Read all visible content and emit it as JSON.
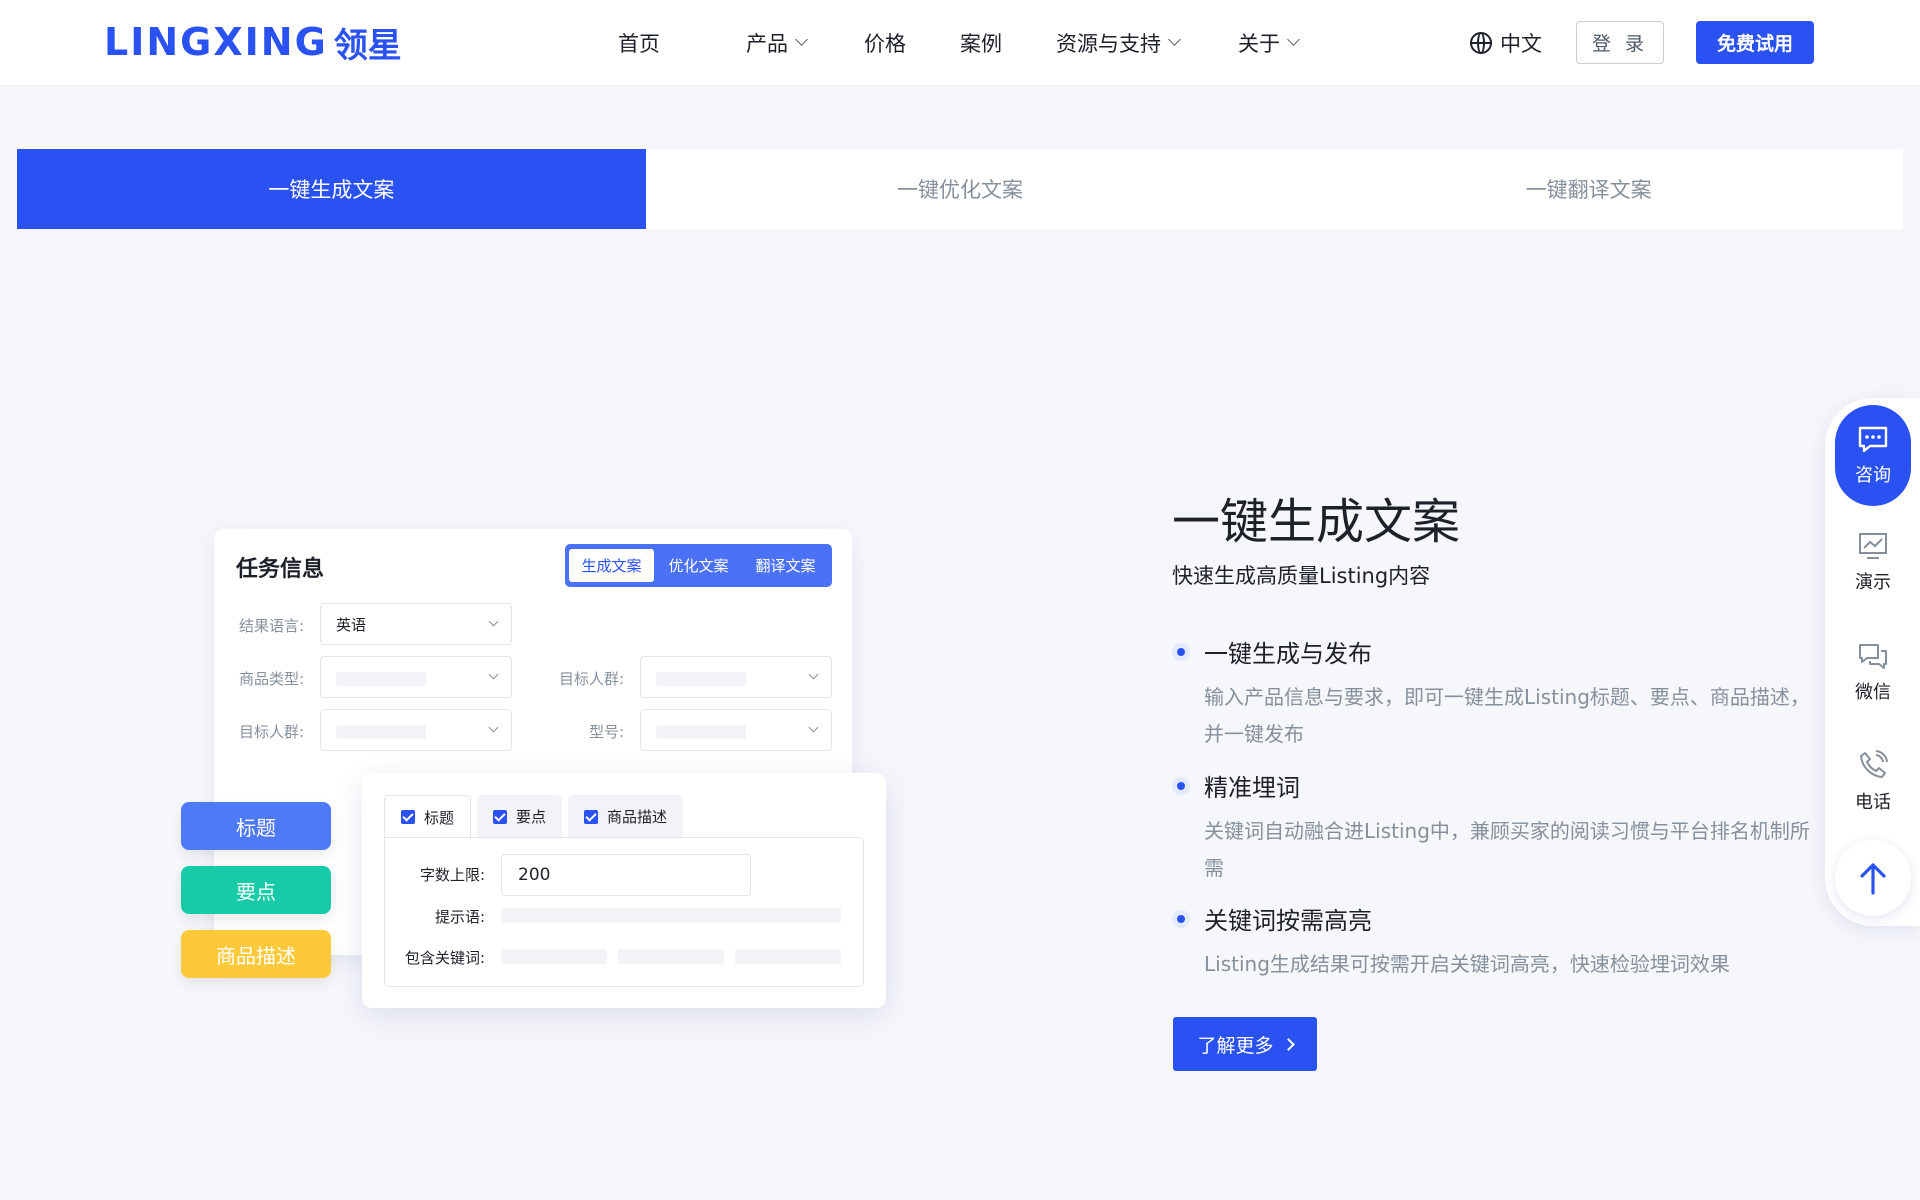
{
  "nav": {
    "logo_en": "LINGXING",
    "logo_cn": "领星",
    "menu": [
      "首页",
      "产品",
      "价格",
      "案例",
      "资源与支持",
      "关于"
    ],
    "lang": "中文",
    "login": "登 录",
    "trial": "免费试用"
  },
  "tabs": [
    "一键生成文案",
    "一键优化文案",
    "一键翻译文案"
  ],
  "illustration": {
    "title": "任务信息",
    "seg": [
      "生成文案",
      "优化文案",
      "翻译文案"
    ],
    "f1_label": "结果语言:",
    "f1_value": "英语",
    "f2_label": "商品类型:",
    "f3_label": "目标人群:",
    "f4_label": "目标人群:",
    "f5_label": "型号:",
    "pills": [
      "标题",
      "要点",
      "商品描述"
    ],
    "sub_tabs": [
      "标题",
      "要点",
      "商品描述"
    ],
    "limit_label": "字数上限:",
    "limit_value": "200",
    "hint_label": "提示语:",
    "keyword_label": "包含关键词:"
  },
  "content": {
    "heading": "一键生成文案",
    "subheading": "快速生成高质量Listing内容",
    "features": [
      {
        "title": "一键生成与发布",
        "desc": "输入产品信息与要求，即可一键生成Listing标题、要点、商品描述，并一键发布"
      },
      {
        "title": "精准埋词",
        "desc": "关键词自动融合进Listing中，兼顾买家的阅读习惯与平台排名机制所需"
      },
      {
        "title": "关键词按需高亮",
        "desc": "Listing生成结果可按需开启关键词高亮，快速检验埋词效果"
      }
    ],
    "more": "了解更多"
  },
  "float": {
    "items": [
      "咨询",
      "演示",
      "微信",
      "电话"
    ]
  },
  "colors": {
    "brand": "#2a52f3",
    "green": "#17cba8",
    "yellow": "#fdc93a"
  }
}
